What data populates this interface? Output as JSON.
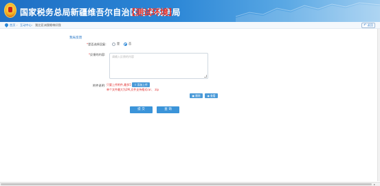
{
  "header": {
    "title": "国家税务总局新疆维吾尔自治区电子税务局",
    "env_tag": "【测试环境】",
    "colors": {
      "banner_start": "#1f6fc4",
      "banner_end": "#9fcdf0",
      "env_tag": "#e8352c"
    }
  },
  "breadcrumb": {
    "home": "首页",
    "center": "互动中心",
    "page": "我比亚洲我眼带好我"
  },
  "back_button": {
    "label": "返回"
  },
  "form": {
    "section_title": "我局反馈",
    "fields": {
      "select_agent": {
        "required_mark": "*",
        "label": "是否选择回复:",
        "options": [
          {
            "label": "是",
            "selected": false
          },
          {
            "label": "否",
            "selected": true
          }
        ]
      },
      "feedback_content": {
        "required_mark": "*",
        "label": "反馈的内容:",
        "placeholder": "请输入反馈的内容"
      },
      "attachment": {
        "label": "附件说明:",
        "hint_1": "只要上传附件,最多5",
        "hint_2": "单个文件最大为2M,文件支持格式rar、 zip",
        "upload_label": "添加上传"
      }
    },
    "delete_label": "删除",
    "preview_label": "查看",
    "submit_label": "提 交",
    "query_label": "查 询"
  }
}
